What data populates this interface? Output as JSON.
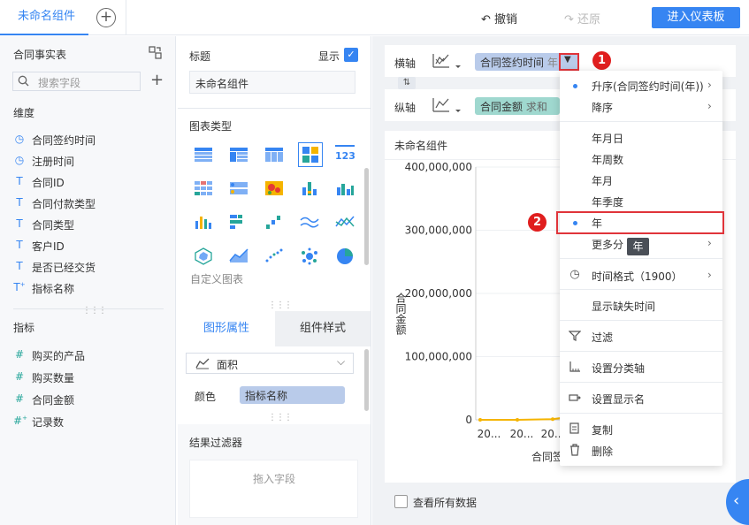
{
  "topbar": {
    "tab_title": "未命名组件",
    "undo_label": "撤销",
    "redo_label": "还原",
    "enter_dashboard_label": "进入仪表板"
  },
  "left_panel": {
    "dataset_name": "合同事实表",
    "search_placeholder": "搜索字段",
    "dimensions_header": "维度",
    "dimensions": [
      {
        "icon": "clock-icon",
        "label": "合同签约时间"
      },
      {
        "icon": "clock-icon",
        "label": "注册时间"
      },
      {
        "icon": "text-icon",
        "label": "合同ID"
      },
      {
        "icon": "text-icon",
        "label": "合同付款类型"
      },
      {
        "icon": "text-icon",
        "label": "合同类型"
      },
      {
        "icon": "text-icon",
        "label": "客户ID"
      },
      {
        "icon": "text-icon",
        "label": "是否已经交货"
      },
      {
        "icon": "text-formula-icon",
        "label": "指标名称"
      }
    ],
    "measures_header": "指标",
    "measures": [
      {
        "icon": "hash-icon",
        "label": "购买的产品"
      },
      {
        "icon": "hash-icon",
        "label": "购买数量"
      },
      {
        "icon": "hash-icon",
        "label": "合同金额"
      },
      {
        "icon": "hash-formula-icon",
        "label": "记录数"
      }
    ]
  },
  "mid_panel": {
    "title_label": "标题",
    "show_label": "显示",
    "title_value": "未命名组件",
    "chart_type_label": "图表类型",
    "custom_chart_label": "自定义图表",
    "tab_shape_attr": "图形属性",
    "tab_component_style": "组件样式",
    "shape_value": "面积",
    "color_label": "颜色",
    "color_field": "指标名称",
    "result_filter_label": "结果过滤器",
    "drag_field_hint": "拖入字段"
  },
  "right_panel": {
    "x_axis_label": "横轴",
    "x_axis_field": "合同签约时间",
    "x_axis_field_suffix": "年",
    "y_axis_label": "纵轴",
    "y_axis_field": "合同金额",
    "y_axis_field_suffix": "求和",
    "chart_title": "未命名组件",
    "view_all_label": "查看所有数据"
  },
  "chart_data": {
    "type": "area",
    "ylabel": "合同金额",
    "xlabel": "合同签",
    "ylim": [
      0,
      400000000
    ],
    "y_ticks": [
      "400,000,000",
      "300,000,000",
      "200,000,000",
      "100,000,000",
      "0"
    ],
    "x_tick_labels": [
      "20...",
      "20...",
      "20..."
    ]
  },
  "menu": {
    "items": [
      {
        "label": "升序(合同签约时间(年))",
        "selected": true,
        "submenu": true
      },
      {
        "label": "降序",
        "submenu": true
      },
      {
        "label": "年月日"
      },
      {
        "label": "年周数"
      },
      {
        "label": "年月"
      },
      {
        "label": "年季度"
      },
      {
        "label": "年",
        "selected": true
      },
      {
        "label": "更多分类",
        "submenu": true
      },
      {
        "label": "时间格式（1900）",
        "submenu": true
      },
      {
        "label": "显示缺失时间"
      },
      {
        "label": "过滤"
      },
      {
        "label": "设置分类轴"
      },
      {
        "label": "设置显示名"
      },
      {
        "label": "复制"
      },
      {
        "label": "删除"
      }
    ],
    "more_category_visible": "更多分",
    "tooltip": "年"
  },
  "annotations": {
    "badge_1": "1",
    "badge_2": "2"
  },
  "colors": {
    "accent": "#3685f2",
    "annotation_red": "#e01e1e",
    "pill_blue": "#b9cbea",
    "pill_teal": "#9fd8cf"
  }
}
